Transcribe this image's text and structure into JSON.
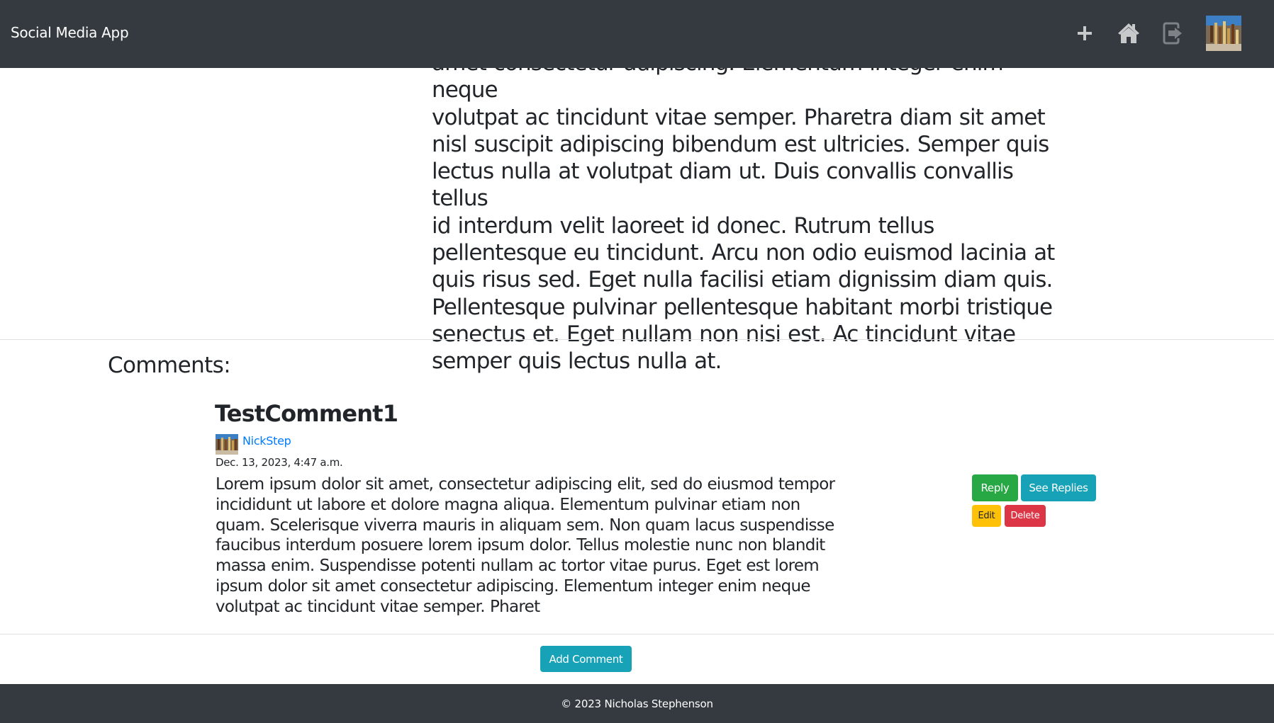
{
  "navbar": {
    "brand": "Social Media App",
    "icons": [
      "plus-icon",
      "home-icon",
      "logout-icon"
    ],
    "colors": {
      "background": "#343a40",
      "icon": "#c8c9cb"
    }
  },
  "post": {
    "body_lines": [
      "amet consectetur adipiscing. Elementum integer enim neque",
      "volutpat ac tincidunt vitae semper. Pharetra diam sit amet",
      "nisl suscipit adipiscing bibendum est ultricies. Semper quis",
      "lectus nulla at volutpat diam ut. Duis convallis convallis tellus",
      "id interdum velit laoreet id donec. Rutrum tellus",
      "pellentesque eu tincidunt. Arcu non odio euismod lacinia at",
      "quis risus sed. Eget nulla facilisi etiam dignissim diam quis.",
      "Pellentesque pulvinar pellentesque habitant morbi tristique",
      "senectus et. Eget nullam non nisi est. Ac tincidunt vitae",
      "semper quis lectus nulla at."
    ]
  },
  "comments": {
    "heading": "Comments:",
    "items": [
      {
        "title": "TestComment1",
        "username": "NickStep",
        "date": "Dec. 13, 2023, 4:47 a.m.",
        "text": "Lorem ipsum dolor sit amet, consectetur adipiscing elit, sed do eiusmod tempor incididunt ut labore et dolore magna aliqua. Elementum pulvinar etiam non quam. Scelerisque viverra mauris in aliquam sem. Non quam lacus suspendisse faucibus interdum posuere lorem ipsum dolor. Tellus molestie nunc non blandit massa enim. Suspendisse potenti nullam ac tortor vitae purus. Eget est lorem ipsum dolor sit amet consectetur adipiscing. Elementum integer enim neque volutpat ac tincidunt vitae semper. Pharet",
        "actions": {
          "reply": "Reply",
          "see_replies": "See Replies",
          "edit": "Edit",
          "delete": "Delete"
        }
      }
    ],
    "add_comment": "Add Comment"
  },
  "colors": {
    "success": "#28a745",
    "info": "#17a2b8",
    "warning": "#ffc107",
    "danger": "#dc3545",
    "link": "#007bff"
  },
  "footer": {
    "text": "© 2023 Nicholas Stephenson"
  }
}
